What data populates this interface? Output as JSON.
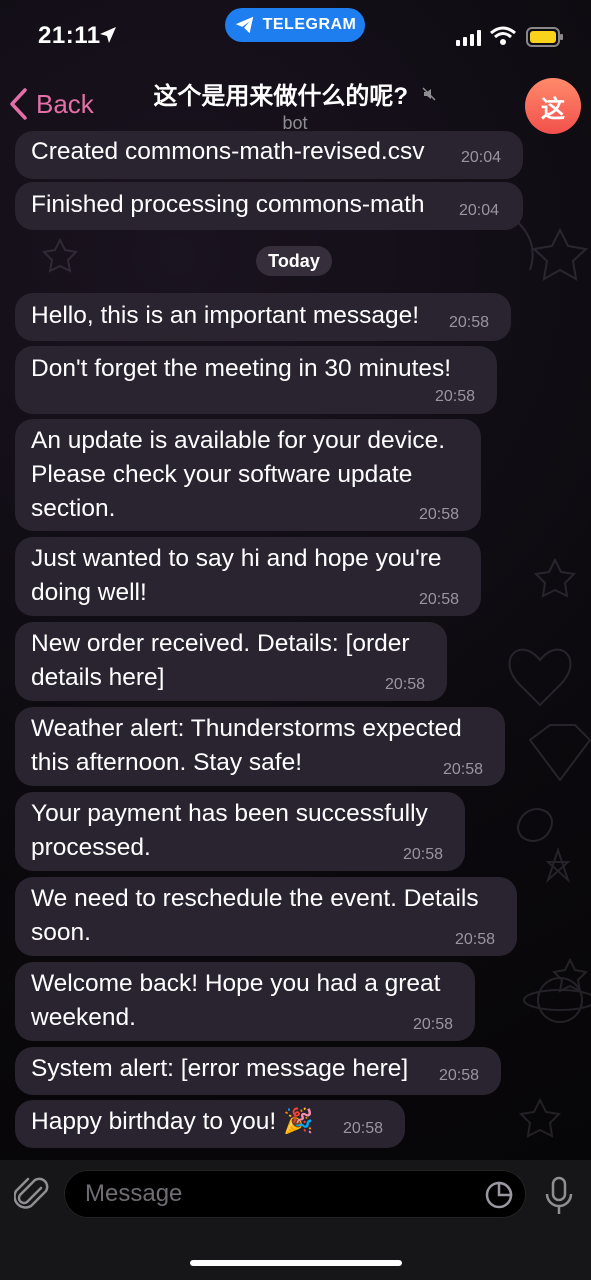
{
  "status_bar": {
    "time": "21:11",
    "app_pill": "TELEGRAM"
  },
  "header": {
    "back_label": "Back",
    "title": "这个是用来做什么的呢?",
    "subtitle": "bot",
    "avatar_letter": "这"
  },
  "date_separator": "Today",
  "messages": [
    {
      "text": "Created commons-math-revised.csv",
      "time": "20:04"
    },
    {
      "text": "Finished processing commons-math",
      "time": "20:04"
    },
    {
      "text": "Hello, this is an important message!",
      "time": "20:58"
    },
    {
      "text": "Don't forget the meeting in 30 minutes!",
      "time": "20:58"
    },
    {
      "text": "An update is available for your device.\nPlease check your software update\nsection.",
      "time": "20:58"
    },
    {
      "text": "Just wanted to say hi and hope you're\ndoing well!",
      "time": "20:58"
    },
    {
      "text": "New order received. Details: [order\ndetails here]",
      "time": "20:58"
    },
    {
      "text": "Weather alert: Thunderstorms expected\nthis afternoon. Stay safe!",
      "time": "20:58"
    },
    {
      "text": "Your payment has been successfully\nprocessed.",
      "time": "20:58"
    },
    {
      "text": "We need to reschedule the event. Details\nsoon.",
      "time": "20:58"
    },
    {
      "text": "Welcome back! Hope you had a great\nweekend.",
      "time": "20:58"
    },
    {
      "text": "System alert: [error message here]",
      "time": "20:58"
    },
    {
      "text": "Happy birthday to you! 🎉",
      "time": "20:58"
    }
  ],
  "input": {
    "placeholder": "Message"
  },
  "colors": {
    "accent": "#e46fa6",
    "bubble": "#2a2431",
    "telegram_blue": "#1e7ef0",
    "avatar": "#f2504b"
  }
}
